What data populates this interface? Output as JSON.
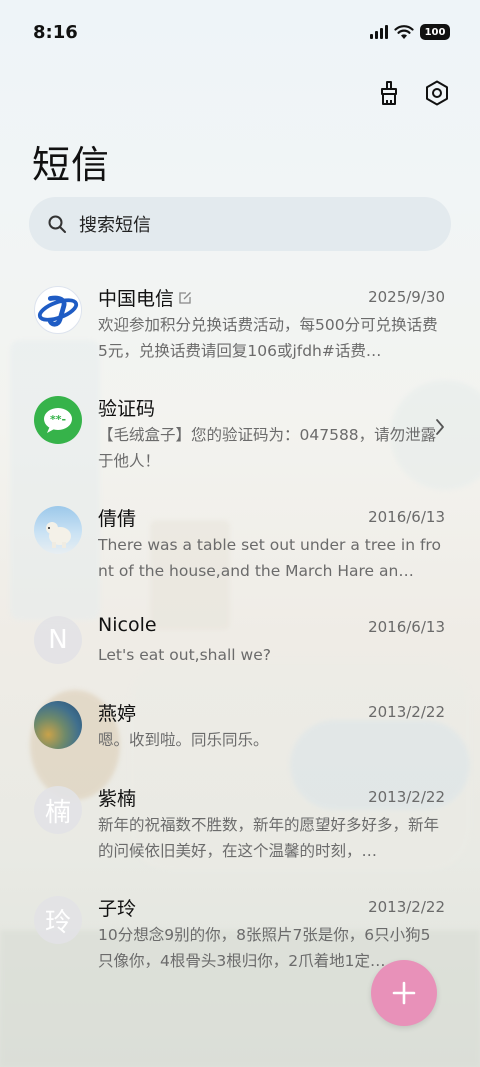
{
  "status_bar": {
    "time": "8:16",
    "battery": "100"
  },
  "header": {
    "title": "短信",
    "clean_icon": "broom-icon",
    "settings_icon": "gear-icon"
  },
  "search": {
    "placeholder": "搜索短信"
  },
  "conversations": [
    {
      "name": "中国电信",
      "date": "2025/9/30",
      "preview": "欢迎参加积分兑换话费活动，每500分可兑换话费5元，兑换话费请回复106或jfdh#话费…",
      "avatar": "china-telecom-logo",
      "accent": "#1f5cc4"
    },
    {
      "name": "验证码",
      "date": "",
      "preview": "【毛绒盒子】您的验证码为：047588，请勿泄露于他人！",
      "avatar": "message-bubble-icon",
      "accent": "#36b34a"
    },
    {
      "name": "倩倩",
      "date": "2016/6/13",
      "preview": "There was a table set out under a tree in front of the house,and the March Hare an…",
      "avatar": "polar-bear-photo"
    },
    {
      "name": "Nicole",
      "date": "2016/6/13",
      "preview": "Let's eat out,shall we?",
      "avatar_letter": "N"
    },
    {
      "name": "燕婷",
      "date": "2013/2/22",
      "preview": "嗯。收到啦。同乐同乐。",
      "avatar": "landscape-photo"
    },
    {
      "name": "紫楠",
      "date": "2013/2/22",
      "preview": "新年的祝福数不胜数，新年的愿望好多好多，新年的问候依旧美好，在这个温馨的时刻，…",
      "avatar_letter": "楠"
    },
    {
      "name": "子玲",
      "date": "2013/2/22",
      "preview": "10分想念9别的你，8张照片7张是你，6只小狗5只像你，4根骨头3根归你，2爪着地1定…",
      "avatar_letter": "玲"
    }
  ],
  "fab": {
    "icon": "plus-icon",
    "color": "#e891b9"
  }
}
